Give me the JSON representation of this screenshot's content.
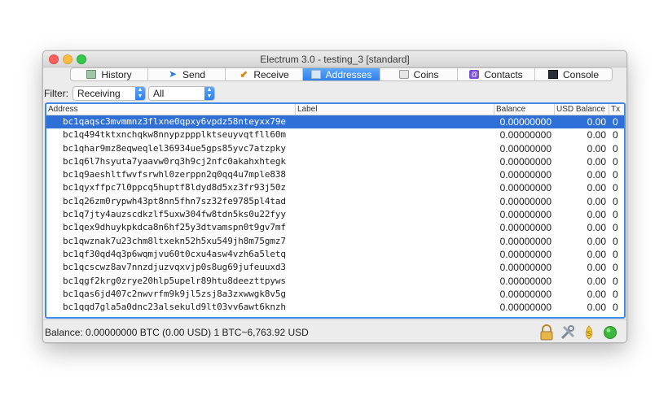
{
  "window": {
    "title": "Electrum 3.0  -  testing_3  [standard]"
  },
  "tabs": [
    {
      "label": "History",
      "icon": "history-icon"
    },
    {
      "label": "Send",
      "icon": "send-icon"
    },
    {
      "label": "Receive",
      "icon": "receive-icon"
    },
    {
      "label": "Addresses",
      "icon": "addresses-icon",
      "active": true
    },
    {
      "label": "Coins",
      "icon": "coins-icon"
    },
    {
      "label": "Contacts",
      "icon": "contacts-icon"
    },
    {
      "label": "Console",
      "icon": "console-icon"
    }
  ],
  "filter": {
    "label": "Filter:",
    "type_value": "Receiving",
    "status_value": "All"
  },
  "table": {
    "headers": {
      "address": "Address",
      "label": "Label",
      "balance": "Balance",
      "usd": "USD Balance",
      "tx": "Tx"
    },
    "rows": [
      {
        "address": "bc1qaqsc3mvmmnz3flxne0qpxy6vpdz58nteyxx79e",
        "label": "",
        "balance": "0.00000000",
        "usd": "0.00",
        "tx": "0"
      },
      {
        "address": "bc1q494tktxnchqkw8nnypzppplktseuyvqtfll60m",
        "label": "",
        "balance": "0.00000000",
        "usd": "0.00",
        "tx": "0"
      },
      {
        "address": "bc1qhar9mz8eqweqlel36934ue5gps85yvc7atzpky",
        "label": "",
        "balance": "0.00000000",
        "usd": "0.00",
        "tx": "0"
      },
      {
        "address": "bc1q6l7hsyuta7yaavw0rq3h9cj2nfc0akahxhtegk",
        "label": "",
        "balance": "0.00000000",
        "usd": "0.00",
        "tx": "0"
      },
      {
        "address": "bc1q9aeshltfwvfsrwhl0zerppn2q0qq4u7mple838",
        "label": "",
        "balance": "0.00000000",
        "usd": "0.00",
        "tx": "0"
      },
      {
        "address": "bc1qyxffpc7l0ppcq5huptf8ldyd8d5xz3fr93j50z",
        "label": "",
        "balance": "0.00000000",
        "usd": "0.00",
        "tx": "0"
      },
      {
        "address": "bc1q26zm0rypwh43pt8nn5fhn7sz32fe9785pl4tad",
        "label": "",
        "balance": "0.00000000",
        "usd": "0.00",
        "tx": "0"
      },
      {
        "address": "bc1q7jty4auzscdkzlf5uxw304fw8tdn5ks0u22fyy",
        "label": "",
        "balance": "0.00000000",
        "usd": "0.00",
        "tx": "0"
      },
      {
        "address": "bc1qex9dhuykpkdca8n6hf25y3dtvamspn0t9gv7mf",
        "label": "",
        "balance": "0.00000000",
        "usd": "0.00",
        "tx": "0"
      },
      {
        "address": "bc1qwznak7u23chm8ltxekn52h5xu549jh8m75gmz7",
        "label": "",
        "balance": "0.00000000",
        "usd": "0.00",
        "tx": "0"
      },
      {
        "address": "bc1qf30qd4q3p6wqmjvu60t0cxu4asw4vzh6a5letq",
        "label": "",
        "balance": "0.00000000",
        "usd": "0.00",
        "tx": "0"
      },
      {
        "address": "bc1qcscwz8av7nnzdjuzvqxvjp0s8ug69jufeuuxd3",
        "label": "",
        "balance": "0.00000000",
        "usd": "0.00",
        "tx": "0"
      },
      {
        "address": "bc1qgf2krg0zrye20hlp5upelr89htu8deezttpyws",
        "label": "",
        "balance": "0.00000000",
        "usd": "0.00",
        "tx": "0"
      },
      {
        "address": "bc1qas6jd407c2nwvrfm9k9jl5zsj8a3zxwwgk8v5g",
        "label": "",
        "balance": "0.00000000",
        "usd": "0.00",
        "tx": "0"
      },
      {
        "address": "bc1qqd7gla5a0dnc23alsekuld9lt03vv6awt6knzh",
        "label": "",
        "balance": "0.00000000",
        "usd": "0.00",
        "tx": "0"
      }
    ]
  },
  "status": {
    "balance_text": "Balance: 0.00000000 BTC (0.00 USD)  1 BTC~6,763.92 USD",
    "icons": [
      "lock-icon",
      "tools-icon",
      "seed-icon",
      "network-status-icon"
    ],
    "network_color": "#3cb83c"
  },
  "colors": {
    "accent": "#2f80ed",
    "selection": "#2f6fd8"
  }
}
